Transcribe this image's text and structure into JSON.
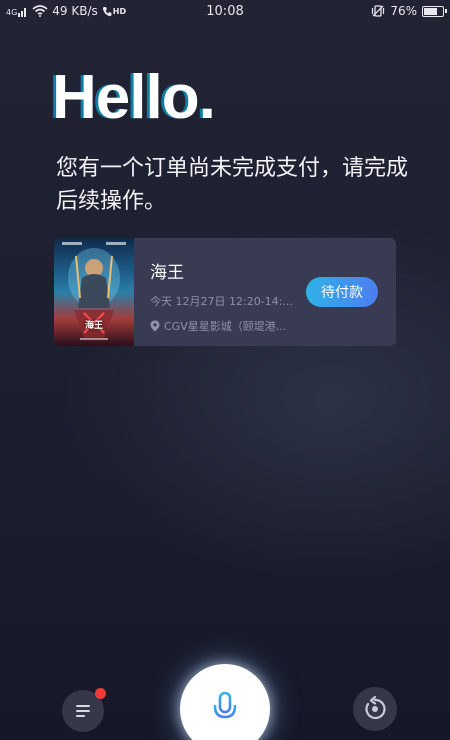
{
  "status_bar": {
    "signal": "4G",
    "net_speed": "49 KB/s",
    "hd": "HD",
    "time": "10:08",
    "battery_text": "76%",
    "battery_level": 0.76
  },
  "greeting": "Hello.",
  "message": "您有一个订单尚未完成支付，请完成后续操作。",
  "order": {
    "movie": "海王",
    "showtime": "今天 12月27日 12:20-14:...",
    "venue": "CGV星星影城（颐堤港...",
    "action": "待付款",
    "poster_title": "海王"
  },
  "colors": {
    "accent_start": "#2fb2e8",
    "accent_end": "#4c7df0",
    "badge": "#f03a3a",
    "card_bg": "#383b51"
  },
  "icons": {
    "list": "list-icon",
    "mic": "microphone-icon",
    "replay": "replay-icon",
    "location": "location-pin-icon"
  }
}
